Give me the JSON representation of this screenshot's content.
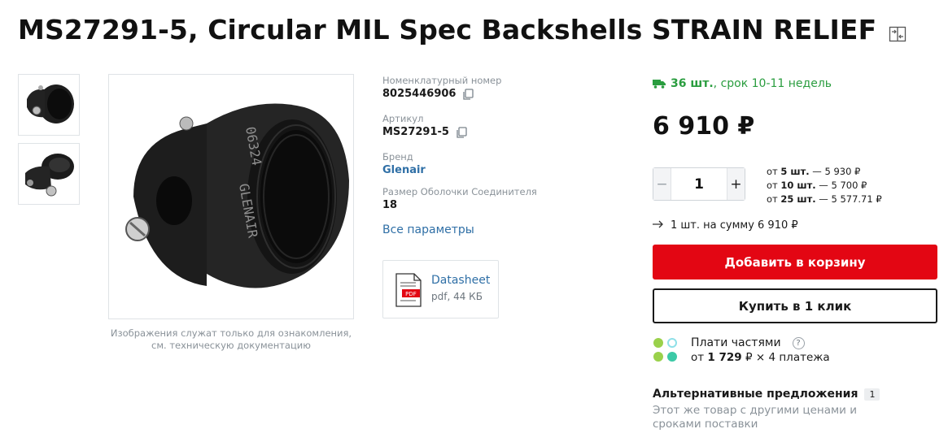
{
  "product": {
    "title": "MS27291-5, Circular MIL Spec Backshells STRAIN RELIEF"
  },
  "gallery": {
    "note": "Изображения служат только для ознакомления, см. техническую документацию",
    "main_print_code": "06324",
    "main_print_brand": "GLENAIR"
  },
  "specs": {
    "catalog_number_label": "Номенклатурный номер",
    "catalog_number_value": "8025446906",
    "article_label": "Артикул",
    "article_value": "MS27291-5",
    "brand_label": "Бренд",
    "brand_value": "Glenair",
    "shell_size_label": "Размер Оболочки Соединителя",
    "shell_size_value": "18",
    "all_params_link": "Все параметры"
  },
  "datasheet": {
    "title": "Datasheet",
    "meta": "pdf, 44 КБ",
    "icon_badge": "PDF"
  },
  "buy": {
    "stock_qty": "36 шт.",
    "stock_term": ", срок 10-11 недель",
    "price": "6 910 ₽",
    "quantity": "1",
    "qty_minus": "−",
    "qty_plus": "+",
    "tiers": [
      {
        "prefix": "от ",
        "qty": "5 шт.",
        "price": " — 5 930 ₽"
      },
      {
        "prefix": "от ",
        "qty": "10 шт.",
        "price": " — 5 700 ₽"
      },
      {
        "prefix": "от ",
        "qty": "25 шт.",
        "price": " — 5 577.71 ₽"
      }
    ],
    "sum_line": "1 шт. на сумму 6 910 ₽",
    "add_to_cart": "Добавить в корзину",
    "one_click": "Купить в 1 клик"
  },
  "installments": {
    "title": "Плати частями",
    "help": "?",
    "from": "от ",
    "amount": "1 729",
    "rest": " ₽ × 4 платежа"
  },
  "alternatives": {
    "title": "Альтернативные предложения",
    "count": "1",
    "description": "Этот же товар с другими ценами и сроками поставки"
  },
  "colors": {
    "accent_red": "#e30613",
    "link_blue": "#2f6fa6",
    "stock_green": "#2a9d3f"
  }
}
